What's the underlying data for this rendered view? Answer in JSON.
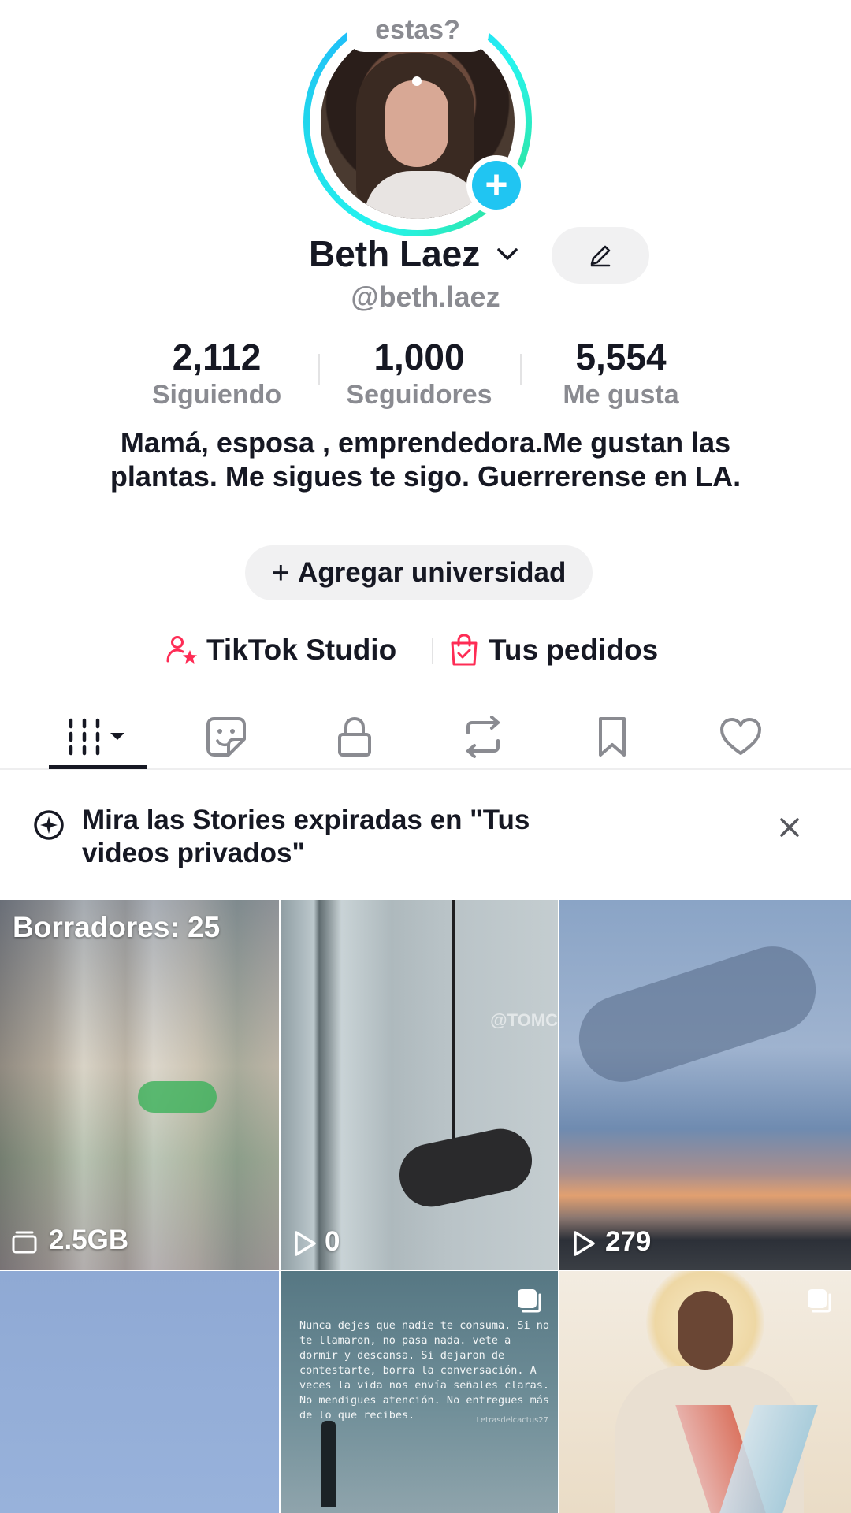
{
  "profile": {
    "avatar_bubble": "estas?",
    "name": "Beth Laez",
    "handle": "@beth.laez",
    "bio": "Mamá, esposa , emprendedora.Me gustan las plantas. Me sigues te sigo. Guerrerense en LA."
  },
  "stats": [
    {
      "value": "2,112",
      "label": "Siguiendo"
    },
    {
      "value": "1,000",
      "label": "Seguidores"
    },
    {
      "value": "5,554",
      "label": "Me gusta"
    }
  ],
  "university_button": {
    "plus": "+",
    "label": "Agregar universidad"
  },
  "links": {
    "studio": "TikTok Studio",
    "orders": "Tus pedidos"
  },
  "tabs": [
    {
      "name": "videos",
      "icon": "grid-icon",
      "active": true
    },
    {
      "name": "stickers",
      "icon": "sticker-icon",
      "active": false
    },
    {
      "name": "private",
      "icon": "lock-icon",
      "active": false
    },
    {
      "name": "reposts",
      "icon": "repost-icon",
      "active": false
    },
    {
      "name": "saved",
      "icon": "bookmark-icon",
      "active": false
    },
    {
      "name": "liked",
      "icon": "heart-icon",
      "active": false
    }
  ],
  "notice": {
    "text": "Mira las Stories expiradas en \"Tus videos privados\""
  },
  "grid": {
    "drafts_label": "Borradores: 25",
    "drafts_size": "2.5GB",
    "video2_views": "0",
    "video2_watermark": "@TOMC",
    "video3_views": "279",
    "quote_text": "Nunca dejes que nadie te consuma. Si no te llamaron, no pasa nada. vete a dormir y descansa. Si dejaron de contestarte, borra la conversación. A veces la vida nos envía señales claras. No mendigues atención. No entregues más de lo que recibes.",
    "quote_signature": "Letrasdelcactus27"
  },
  "colors": {
    "accent_pink": "#fe2c55",
    "accent_cyan": "#20c5f2",
    "text_primary": "#161823",
    "text_secondary": "#8a8b91"
  }
}
